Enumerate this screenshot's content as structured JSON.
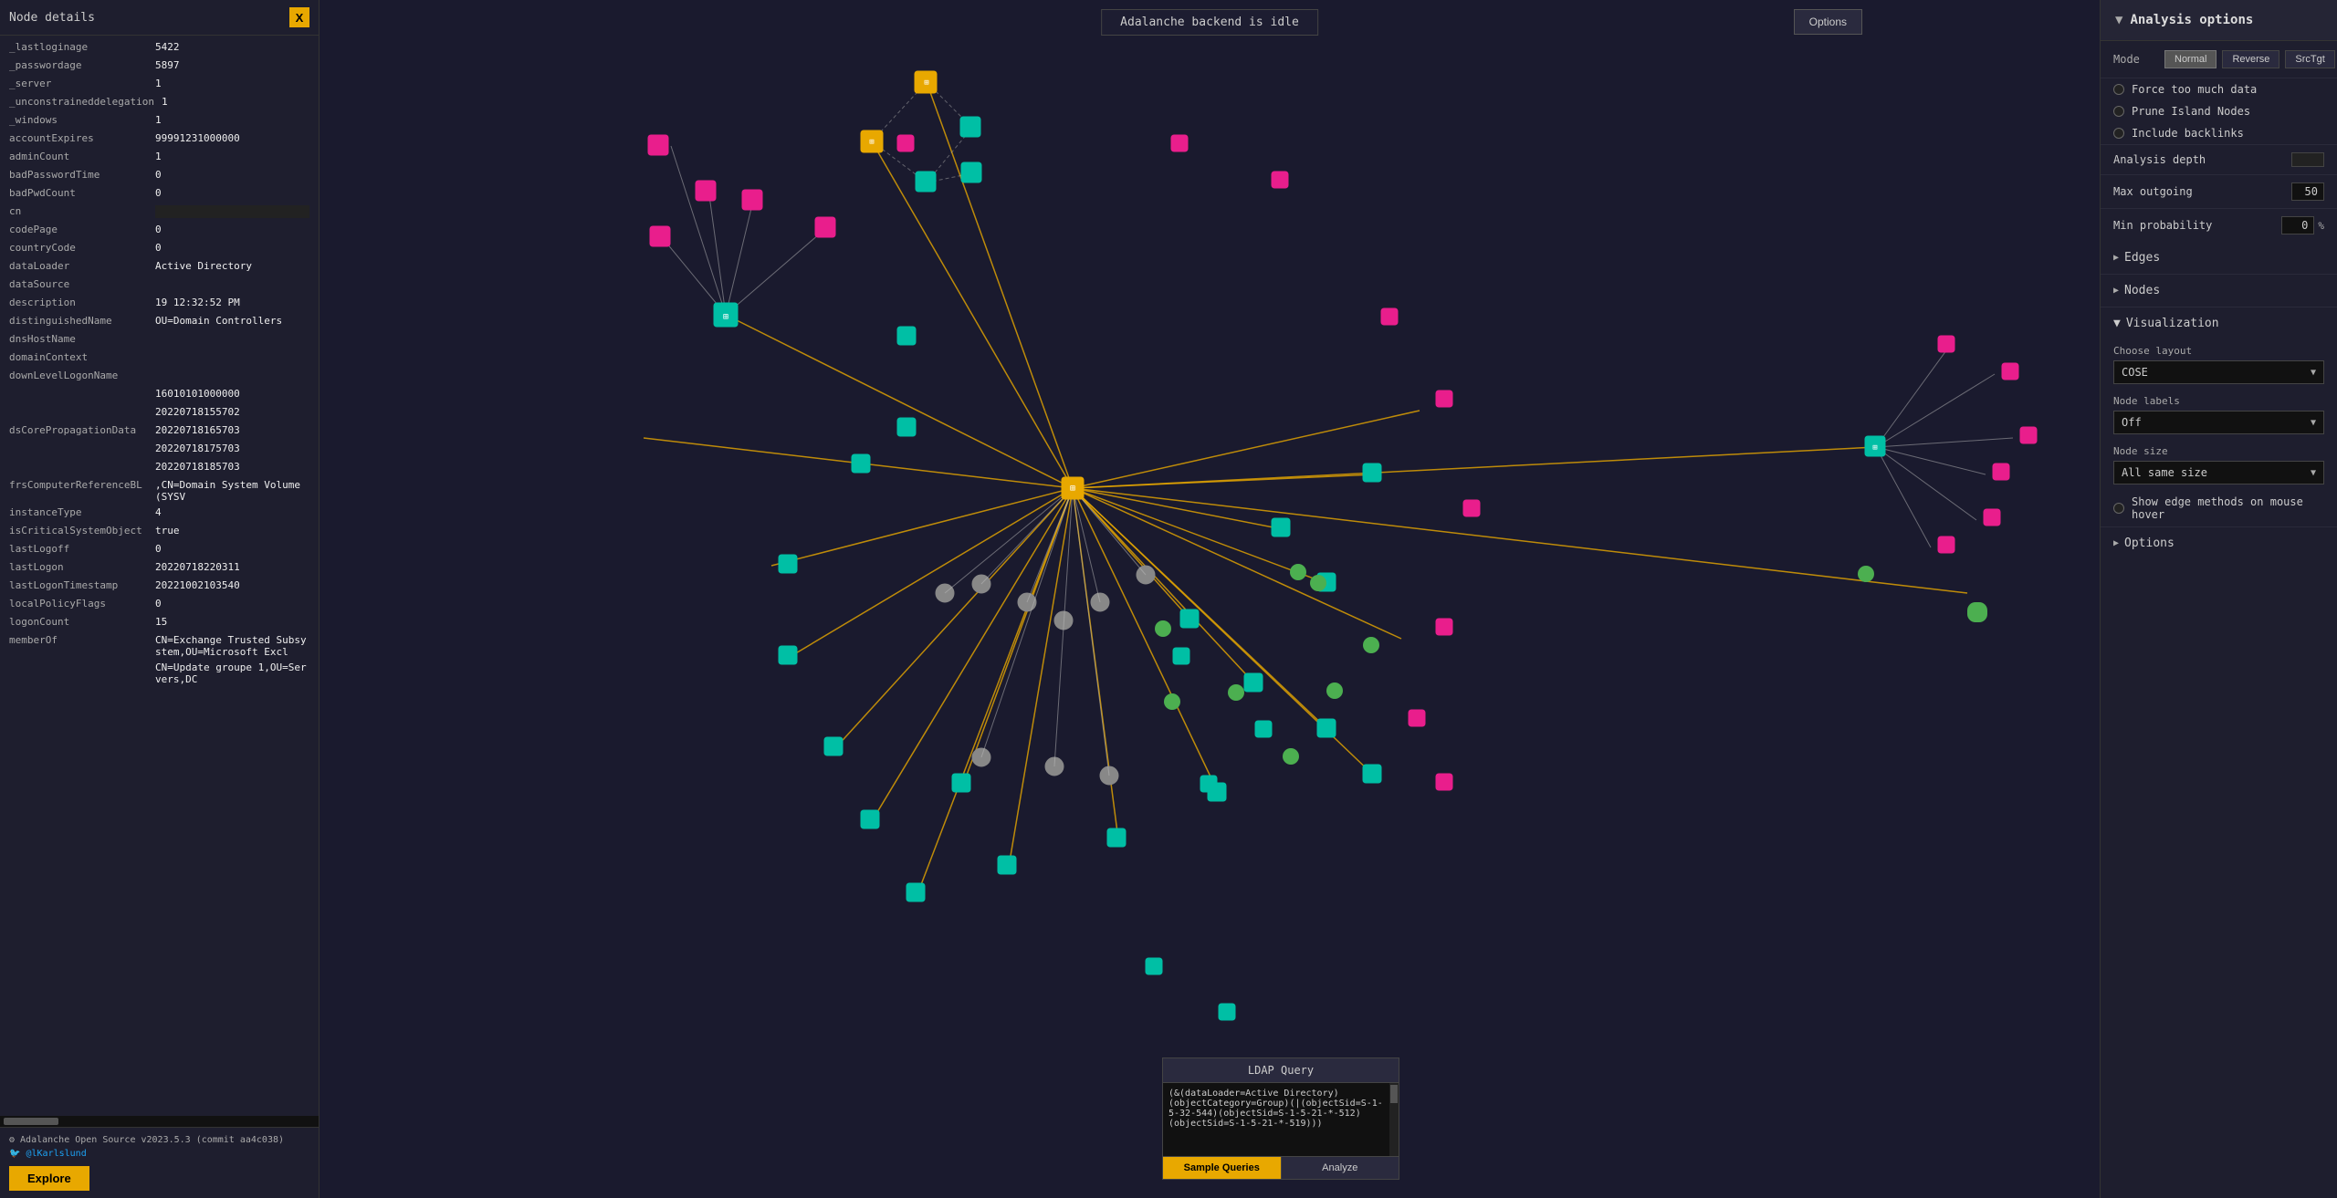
{
  "leftPanel": {
    "title": "Node details",
    "closeBtn": "X",
    "properties": [
      {
        "key": "_lastloginage",
        "value": "5422"
      },
      {
        "key": "_passwordage",
        "value": "5897"
      },
      {
        "key": "_server",
        "value": "1"
      },
      {
        "key": "_unconstraineddelegation",
        "value": "1"
      },
      {
        "key": "_windows",
        "value": "1"
      },
      {
        "key": "accountExpires",
        "value": "99991231000000"
      },
      {
        "key": "adminCount",
        "value": "1"
      },
      {
        "key": "badPasswordTime",
        "value": "0"
      },
      {
        "key": "badPwdCount",
        "value": "0"
      },
      {
        "key": "cn",
        "value": ""
      },
      {
        "key": "codePage",
        "value": "0"
      },
      {
        "key": "countryCode",
        "value": "0"
      },
      {
        "key": "dataLoader",
        "value": "Active Directory"
      },
      {
        "key": "dataSource",
        "value": ""
      },
      {
        "key": "description",
        "value": "19 12:32:52 PM"
      },
      {
        "key": "distinguishedName",
        "value": "OU=Domain Controllers"
      },
      {
        "key": "dnsHostName",
        "value": ""
      },
      {
        "key": "domainContext",
        "value": ""
      },
      {
        "key": "downLevelLogonName",
        "value": ""
      },
      {
        "key": "",
        "value": "16010101000000"
      },
      {
        "key": "",
        "value": "20220718155702"
      },
      {
        "key": "dsCorePropagationData",
        "value": "20220718165703"
      },
      {
        "key": "",
        "value": "20220718175703"
      },
      {
        "key": "",
        "value": "20220718185703"
      },
      {
        "key": "frsComputerReferenceBL",
        "value": ",CN=Domain System Volume (SYSV"
      },
      {
        "key": "instanceType",
        "value": "4"
      },
      {
        "key": "isCriticalSystemObject",
        "value": "true"
      },
      {
        "key": "lastLogoff",
        "value": "0"
      },
      {
        "key": "lastLogon",
        "value": "20220718220311"
      },
      {
        "key": "lastLogonTimestamp",
        "value": "20221002103540"
      },
      {
        "key": "localPolicyFlags",
        "value": "0"
      },
      {
        "key": "logonCount",
        "value": "15"
      },
      {
        "key": "memberOf",
        "value": "CN=Exchange Trusted Subsystem,OU=Microsoft Excl"
      },
      {
        "key": "",
        "value": "CN=Update groupe 1,OU=Servers,DC"
      }
    ],
    "versionInfo": "Adalanche Open Source v2023.5.3 (commit aa4c038)",
    "twitterHandle": "@lKarlslund",
    "exploreBtn": "Explore"
  },
  "statusBar": {
    "message": "Adalanche backend is idle"
  },
  "optionsBtn": "Options",
  "rightPanel": {
    "title": "Analysis options",
    "chevron": "▼",
    "modeLabel": "Mode",
    "modes": [
      {
        "label": "Normal",
        "active": true
      },
      {
        "label": "Reverse",
        "active": false
      },
      {
        "label": "SrcTgt",
        "active": false
      }
    ],
    "checkboxes": [
      {
        "label": "Force too much data",
        "checked": false
      },
      {
        "label": "Prune Island Nodes",
        "checked": false
      },
      {
        "label": "Include backlinks",
        "checked": false
      }
    ],
    "analysisDepth": {
      "label": "Analysis depth",
      "value": ""
    },
    "maxOutgoing": {
      "label": "Max outgoing",
      "value": "50"
    },
    "minProbability": {
      "label": "Min probability",
      "value": "0",
      "suffix": "%"
    },
    "edges": {
      "label": "Edges",
      "chevron": "▶"
    },
    "nodes": {
      "label": "Nodes",
      "chevron": "▶"
    },
    "visualization": {
      "label": "Visualization",
      "chevron": "▼",
      "chooseLayout": "Choose layout",
      "layout": {
        "value": "COSE",
        "arrow": "▼"
      },
      "nodeLabels": {
        "label": "Node labels",
        "value": "Off",
        "arrow": "▼"
      },
      "nodeSize": {
        "label": "Node size",
        "value": "All same size",
        "arrow": "▼"
      },
      "showEdgeMethods": {
        "label": "Show edge methods on mouse hover",
        "checked": false
      }
    },
    "optionsSection": {
      "label": "Options",
      "chevron": "▶"
    }
  },
  "ldapPanel": {
    "title": "LDAP Query",
    "query": "(&(dataLoader=Active Directory)(objectCategory=Group)(|(objectSid=S-1-5-32-544)(objectSid=S-1-5-21-*-512)(objectSid=S-1-5-21-*-519)))",
    "sampleQueriesBtn": "Sample Queries",
    "analyzeBtn": "Analyze"
  },
  "icons": {
    "adalanche": "⚙",
    "chevronDown": "▼",
    "chevronRight": "▶",
    "close": "✕"
  }
}
